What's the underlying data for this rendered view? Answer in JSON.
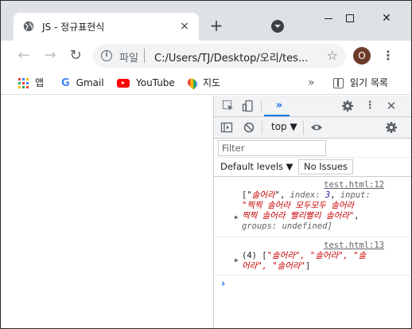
{
  "tab": {
    "title": "JS - 정규표현식",
    "close": "×"
  },
  "newtab": "+",
  "window_controls": {
    "close": "✕"
  },
  "toolbar": {
    "back": "←",
    "forward": "→",
    "reload": "↻",
    "scheme": "파일",
    "url": "C:/Users/TJ/Desktop/오리/tes...",
    "star": "☆",
    "profile_initial": "O",
    "menu": "⋮"
  },
  "bookmarks": {
    "apps": "앱",
    "gmail": "Gmail",
    "youtube": "YouTube",
    "maps": "지도",
    "more": "»",
    "reading_list": "읽기 목록"
  },
  "devtools": {
    "more_tabs": "»",
    "kebab": "⋮",
    "close": "✕",
    "context": "top ▼",
    "filter_placeholder": "Filter",
    "levels": "Default levels ▼",
    "issues": "No Issues",
    "logs": [
      {
        "source": "test.html:12",
        "line1_a": "[\"",
        "line1_s": "솔어라",
        "line1_b": "\", ",
        "line1_k1": "index:",
        "line1_n": " 3",
        "line1_c": ", ",
        "line1_k2": "input:",
        "line2": "\"찍찍 솔어라 모두모두 솔어라",
        "line3": "찍찍 솔어라 빨리빨리 솔어라\"",
        "line3_tail": ",",
        "line4": "groups: undefined]"
      },
      {
        "source": "test.html:13",
        "count": "(4) [",
        "line1_s": "\"솔어라\", \"솔어라\", \"솔",
        "line2_s": "어라\", \"솔어라\"",
        "line2_end": "]"
      }
    ],
    "prompt": "›"
  }
}
